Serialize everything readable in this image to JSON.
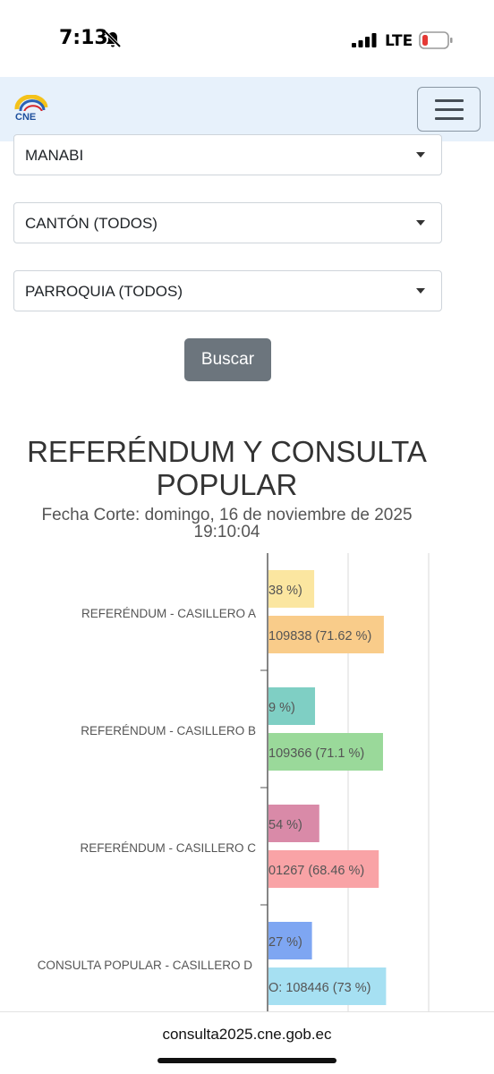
{
  "status_bar": {
    "time": "7:13",
    "network": "LTE",
    "battery_color": "#e53935"
  },
  "navbar": {
    "bg": "#e7f1fb",
    "logo_icon": "cne-logo-icon",
    "menu_icon": "hamburger-icon"
  },
  "filters": {
    "provincia": "MANABI",
    "canton": "CANTÓN (TODOS)",
    "parroquia": "PARROQUIA (TODOS)"
  },
  "search": {
    "button_label": "Buscar"
  },
  "report": {
    "title_line1": "REFERÉNDUM Y CONSULTA",
    "title_line2": "POPULAR",
    "cutoff_line1": "Fecha Corte: domingo, 16 de noviembre de 2025",
    "cutoff_line2": "19:10:04"
  },
  "chart_data": {
    "type": "bar",
    "orientation": "horizontal",
    "categories": [
      "REFERÉNDUM - CASILLERO A",
      "REFERÉNDUM - CASILLERO B",
      "REFERÉNDUM - CASILLERO C",
      "CONSULTA POPULAR - CASILLERO D"
    ],
    "bars": [
      {
        "category": 0,
        "label": "38 %)",
        "color": "#fbe6a0",
        "value": 28.38
      },
      {
        "category": 0,
        "label": "109838 (71.62 %)",
        "color": "#f9cc8a",
        "value": 71.62
      },
      {
        "category": 1,
        "label": "9 %)",
        "color": "#7fcfc4",
        "value": 28.9
      },
      {
        "category": 1,
        "label": "109366 (71.1 %)",
        "color": "#9ad99a",
        "value": 71.1
      },
      {
        "category": 2,
        "label": "54 %)",
        "color": "#d98aa8",
        "value": 31.54
      },
      {
        "category": 2,
        "label": "01267 (68.46 %)",
        "color": "#f9a3a6",
        "value": 68.46
      },
      {
        "category": 3,
        "label": "27 %)",
        "color": "#7ea6f2",
        "value": 27
      },
      {
        "category": 3,
        "label": "O: 108446 (73 %)",
        "color": "#a6e0f2",
        "value": 73
      }
    ],
    "grid": true
  }
}
